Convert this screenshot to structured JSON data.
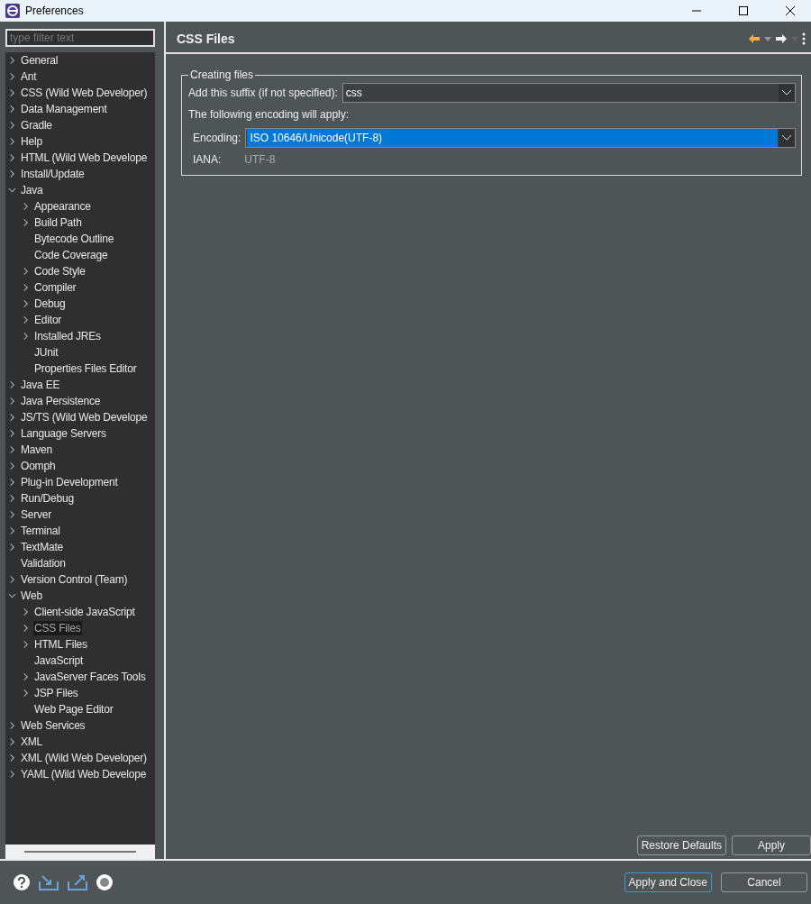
{
  "window": {
    "title": "Preferences"
  },
  "filter": {
    "placeholder": "type filter text"
  },
  "tree": [
    {
      "label": "General",
      "kind": "folder",
      "expanded": false,
      "selected": false
    },
    {
      "label": "Ant",
      "kind": "folder",
      "expanded": false,
      "selected": false
    },
    {
      "label": "CSS (Wild Web Developer)",
      "kind": "folder",
      "expanded": false,
      "selected": false
    },
    {
      "label": "Data Management",
      "kind": "folder",
      "expanded": false,
      "selected": false
    },
    {
      "label": "Gradle",
      "kind": "folder",
      "expanded": false,
      "selected": false
    },
    {
      "label": "Help",
      "kind": "folder",
      "expanded": false,
      "selected": false
    },
    {
      "label": "HTML (Wild Web Develope",
      "kind": "folder",
      "expanded": false,
      "selected": false
    },
    {
      "label": "Install/Update",
      "kind": "folder",
      "expanded": false,
      "selected": false
    },
    {
      "label": "Java",
      "kind": "folder",
      "expanded": true,
      "selected": false,
      "children": [
        {
          "label": "Appearance",
          "kind": "folder",
          "expanded": false,
          "selected": false
        },
        {
          "label": "Build Path",
          "kind": "folder",
          "expanded": false,
          "selected": false
        },
        {
          "label": "Bytecode Outline",
          "kind": "leaf",
          "selected": false
        },
        {
          "label": "Code Coverage",
          "kind": "leaf",
          "selected": false
        },
        {
          "label": "Code Style",
          "kind": "folder",
          "expanded": false,
          "selected": false
        },
        {
          "label": "Compiler",
          "kind": "folder",
          "expanded": false,
          "selected": false
        },
        {
          "label": "Debug",
          "kind": "folder",
          "expanded": false,
          "selected": false
        },
        {
          "label": "Editor",
          "kind": "folder",
          "expanded": false,
          "selected": false
        },
        {
          "label": "Installed JREs",
          "kind": "folder",
          "expanded": false,
          "selected": false
        },
        {
          "label": "JUnit",
          "kind": "leaf",
          "selected": false
        },
        {
          "label": "Properties Files Editor",
          "kind": "leaf",
          "selected": false
        }
      ]
    },
    {
      "label": "Java EE",
      "kind": "folder",
      "expanded": false,
      "selected": false
    },
    {
      "label": "Java Persistence",
      "kind": "folder",
      "expanded": false,
      "selected": false
    },
    {
      "label": "JS/TS (Wild Web Develope",
      "kind": "folder",
      "expanded": false,
      "selected": false
    },
    {
      "label": "Language Servers",
      "kind": "folder",
      "expanded": false,
      "selected": false
    },
    {
      "label": "Maven",
      "kind": "folder",
      "expanded": false,
      "selected": false
    },
    {
      "label": "Oomph",
      "kind": "folder",
      "expanded": false,
      "selected": false
    },
    {
      "label": "Plug-in Development",
      "kind": "folder",
      "expanded": false,
      "selected": false
    },
    {
      "label": "Run/Debug",
      "kind": "folder",
      "expanded": false,
      "selected": false
    },
    {
      "label": "Server",
      "kind": "folder",
      "expanded": false,
      "selected": false
    },
    {
      "label": "Terminal",
      "kind": "folder",
      "expanded": false,
      "selected": false
    },
    {
      "label": "TextMate",
      "kind": "folder",
      "expanded": false,
      "selected": false
    },
    {
      "label": "Validation",
      "kind": "leaf",
      "selected": false
    },
    {
      "label": "Version Control (Team)",
      "kind": "folder",
      "expanded": false,
      "selected": false
    },
    {
      "label": "Web",
      "kind": "folder",
      "expanded": true,
      "selected": false,
      "children": [
        {
          "label": "Client-side JavaScript",
          "kind": "folder",
          "expanded": false,
          "selected": false
        },
        {
          "label": "CSS Files",
          "kind": "folder",
          "expanded": false,
          "selected": true
        },
        {
          "label": "HTML Files",
          "kind": "folder",
          "expanded": false,
          "selected": false
        },
        {
          "label": "JavaScript",
          "kind": "leaf",
          "selected": false
        },
        {
          "label": "JavaServer Faces Tools",
          "kind": "folder",
          "expanded": false,
          "selected": false
        },
        {
          "label": "JSP Files",
          "kind": "folder",
          "expanded": false,
          "selected": false
        },
        {
          "label": "Web Page Editor",
          "kind": "leaf",
          "selected": false
        }
      ]
    },
    {
      "label": "Web Services",
      "kind": "folder",
      "expanded": false,
      "selected": false
    },
    {
      "label": "XML",
      "kind": "folder",
      "expanded": false,
      "selected": false
    },
    {
      "label": "XML (Wild Web Developer)",
      "kind": "folder",
      "expanded": false,
      "selected": false
    },
    {
      "label": "YAML (Wild Web Develope",
      "kind": "folder",
      "expanded": false,
      "selected": false
    }
  ],
  "page": {
    "title": "CSS Files",
    "group": {
      "title": "Creating files",
      "suffix_label": "Add this suffix (if not specified):",
      "suffix_value": "css",
      "encoding_note": "The following encoding will apply:",
      "encoding_label": "Encoding:",
      "encoding_value": "ISO 10646/Unicode(UTF-8)",
      "iana_label": "IANA:",
      "iana_value": "UTF-8"
    },
    "buttons": [
      "Restore Defaults",
      "Apply"
    ]
  },
  "footer_buttons": [
    {
      "label": "Apply and Close",
      "selected": true
    },
    {
      "label": "Cancel",
      "selected": false
    }
  ]
}
